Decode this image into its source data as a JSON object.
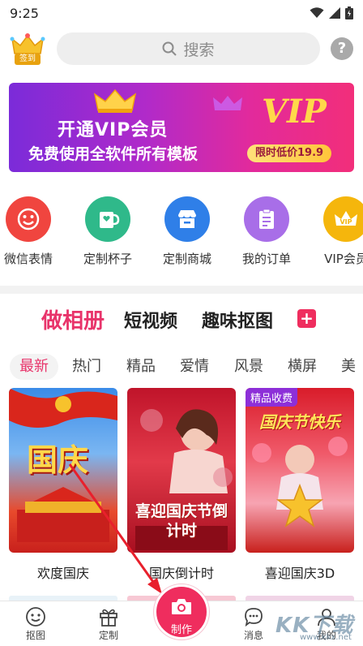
{
  "status_bar": {
    "time": "9:25"
  },
  "topbar": {
    "signin_label": "签到",
    "search_placeholder": "搜索",
    "help_label": "?"
  },
  "banner": {
    "title": "开通VIP会员",
    "subtitle": "免费使用全软件所有模板",
    "vip_text": "VIP",
    "price_text": "限时低价19.9"
  },
  "categories": [
    {
      "label": "微信表情",
      "icon": "smiley-icon",
      "color": "#f0453f"
    },
    {
      "label": "定制杯子",
      "icon": "mug-icon",
      "color": "#2fb98a"
    },
    {
      "label": "定制商城",
      "icon": "store-icon",
      "color": "#2f7fe8"
    },
    {
      "label": "我的订单",
      "icon": "order-icon",
      "color": "#a86ee8"
    },
    {
      "label": "VIP会员",
      "icon": "vip-crown-icon",
      "color": "#f5b60c"
    }
  ],
  "main_tabs": [
    "做相册",
    "短视频",
    "趣味抠图"
  ],
  "sub_tabs": [
    "最新",
    "热门",
    "精品",
    "爱情",
    "风景",
    "横屏",
    "美"
  ],
  "cards": [
    {
      "title": "欢度国庆",
      "image_text": "国庆",
      "badge": ""
    },
    {
      "title": "国庆倒计时",
      "image_text": "喜迎国庆节倒计时",
      "badge": ""
    },
    {
      "title": "喜迎国庆3D",
      "image_text": "国庆节快乐",
      "badge": "精品收费"
    }
  ],
  "bottom_nav": {
    "cutout": "抠图",
    "custom": "定制",
    "make": "制作",
    "messages": "消息",
    "mine": "我的"
  },
  "watermark": {
    "text": "KK下载",
    "url": "www.kkx.net"
  },
  "colors": {
    "accent": "#ef2d5e",
    "active_tab": "#e8336a"
  }
}
